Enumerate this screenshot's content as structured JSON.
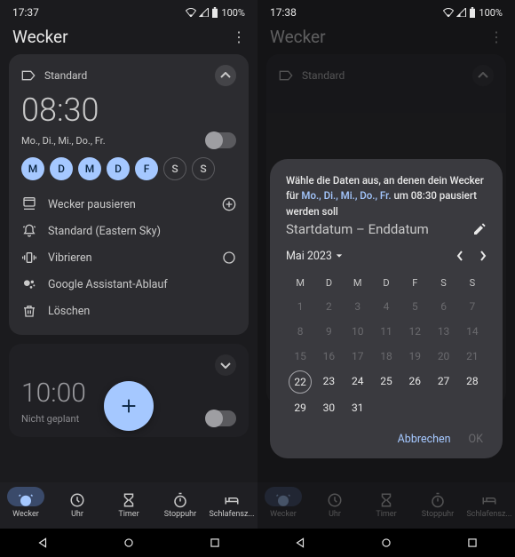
{
  "left": {
    "status": {
      "time": "17:37",
      "battery": "100%"
    },
    "title": "Wecker",
    "alarm1": {
      "label": "Standard",
      "time": "08:30",
      "days_text": "Mo., Di., Mi., Do., Fr.",
      "day_letters": [
        "M",
        "D",
        "M",
        "D",
        "F",
        "S",
        "S"
      ],
      "actions": {
        "pause": "Wecker pausieren",
        "ringtone": "Standard (Eastern Sky)",
        "vibrate": "Vibrieren",
        "assistant": "Google Assistant-Ablauf",
        "delete": "Löschen"
      }
    },
    "alarm2": {
      "time": "10:00",
      "status": "Nicht geplant"
    }
  },
  "right": {
    "status": {
      "time": "17:38",
      "battery": "100%"
    },
    "title": "Wecker",
    "alarm1": {
      "label": "Standard"
    },
    "dialog": {
      "prompt_pre": "Wähle die Daten aus, an denen dein Wecker für ",
      "prompt_days": "Mo., Di., Mi., Do., Fr.",
      "prompt_post": " um 08:30 pausiert werden soll",
      "range_label": "Startdatum – Enddatum",
      "month": "Mai 2023",
      "weekdays": [
        "M",
        "D",
        "M",
        "D",
        "F",
        "S",
        "S"
      ],
      "today": 22,
      "cancel": "Abbrechen",
      "ok": "OK"
    }
  },
  "nav": {
    "items": [
      {
        "label": "Wecker"
      },
      {
        "label": "Uhr"
      },
      {
        "label": "Timer"
      },
      {
        "label": "Stoppuhr"
      },
      {
        "label": "Schlafensz..."
      }
    ]
  }
}
